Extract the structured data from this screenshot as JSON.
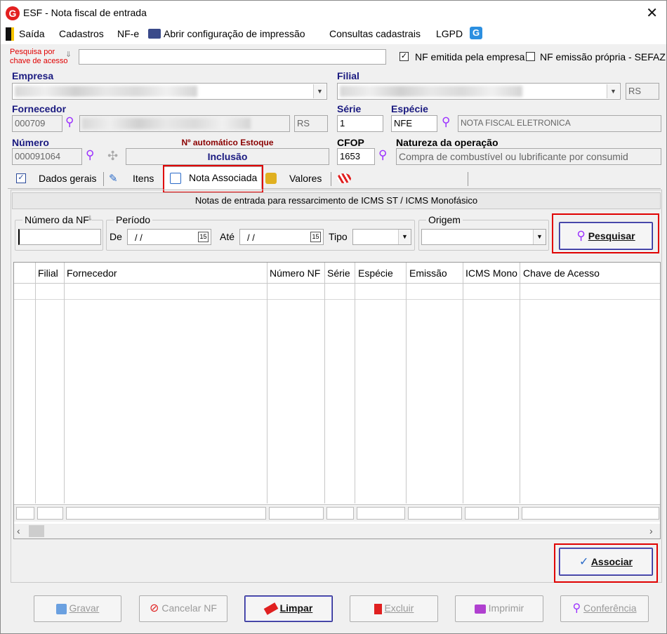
{
  "window": {
    "title": "ESF - Nota fiscal de entrada",
    "logo": "G",
    "close": "✕"
  },
  "menu": {
    "saida": "Saída",
    "cadastros": "Cadastros",
    "nfe": "NF-e",
    "print_config": "Abrir configuração de impressão",
    "consultas": "Consultas cadastrais",
    "lgpd": "LGPD"
  },
  "search": {
    "label_line1": "Pesquisa por",
    "label_line2": "chave de acesso",
    "value": ""
  },
  "checks": {
    "emitida_label": "NF emitida pela empresa",
    "emitida_checked": "✓",
    "propria_label": "NF emissão própria - SEFAZ"
  },
  "empresa": {
    "label": "Empresa"
  },
  "filial": {
    "label": "Filial",
    "uf": "RS"
  },
  "fornecedor": {
    "label": "Fornecedor",
    "code": "000709",
    "uf": "RS"
  },
  "serie": {
    "label": "Série",
    "value": "1"
  },
  "especie": {
    "label": "Espécie",
    "value": "NFE",
    "desc": "NOTA FISCAL ELETRONICA"
  },
  "numero": {
    "label": "Número",
    "value": "000091064",
    "auto_label": "Nº automático Estoque",
    "status": "Inclusão"
  },
  "cfop": {
    "label": "CFOP",
    "value": "1653"
  },
  "natureza": {
    "label": "Natureza da operação",
    "value": "Compra de combustível ou lubrificante por consumid"
  },
  "tabs": {
    "dados": "Dados gerais",
    "itens": "Itens",
    "nota": "Nota Associada",
    "valores": "Valores"
  },
  "panel": {
    "header": "Notas de entrada para ressarcimento de ICMS ST / ICMS Monofásico",
    "numero_nf": "Número da NF",
    "periodo": "Período",
    "de": "De",
    "ate": "Até",
    "date_from": "/ /",
    "date_to": "/ /",
    "tipo": "Tipo",
    "origem": "Origem",
    "pesquisar": "Pesquisar",
    "associar": "Associar"
  },
  "grid": {
    "columns": [
      "Filial",
      "Fornecedor",
      "Número NF",
      "Série",
      "Espécie",
      "Emissão",
      "ICMS Mono",
      "Chave de Acesso"
    ]
  },
  "buttons": {
    "gravar": "Gravar",
    "cancelar": "Cancelar NF",
    "limpar": "Limpar",
    "excluir": "Excluir",
    "imprimir": "Imprimir",
    "conferencia": "Conferência"
  },
  "colors": {
    "accent_red": "#e00000",
    "label_blue": "#1a1a80",
    "search_purple": "#9b30ff"
  }
}
